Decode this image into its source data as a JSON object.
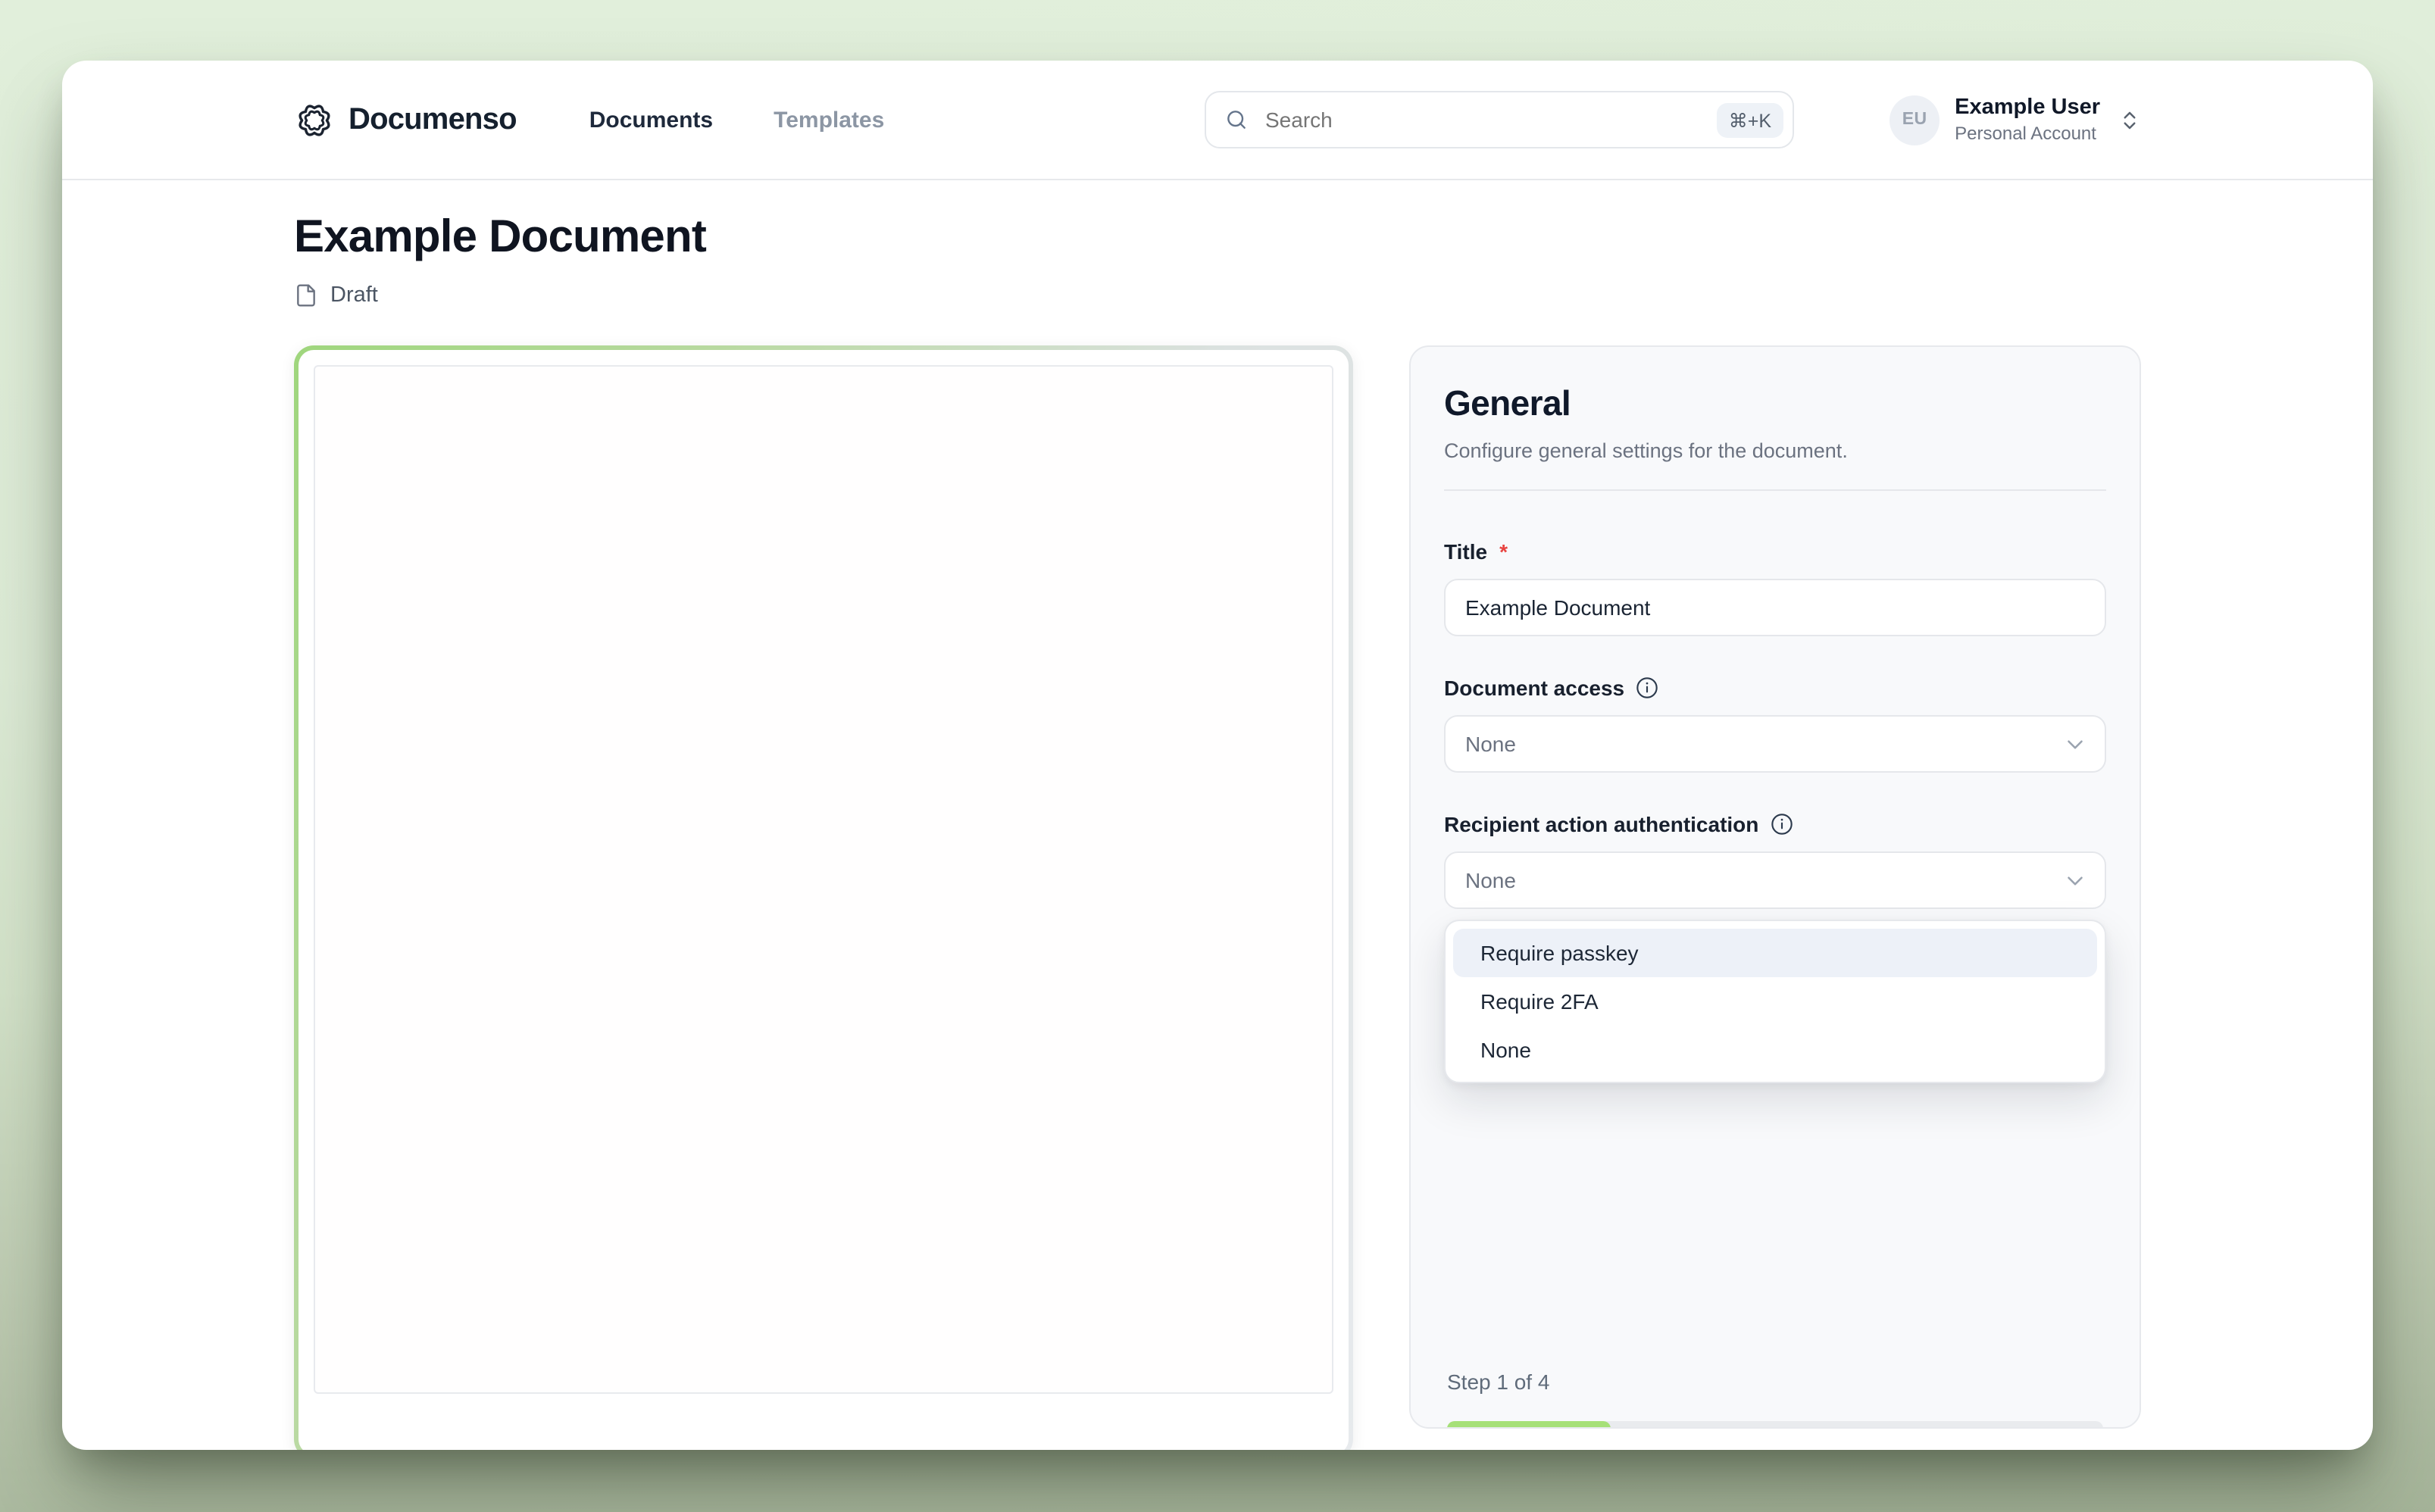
{
  "header": {
    "logo_text": "Documenso",
    "nav": [
      {
        "label": "Documents",
        "active": true
      },
      {
        "label": "Templates",
        "active": false
      }
    ],
    "search": {
      "placeholder": "Search",
      "shortcut": "⌘+K"
    },
    "user": {
      "initials": "EU",
      "name": "Example User",
      "account_type": "Personal Account"
    }
  },
  "document": {
    "title": "Example Document",
    "status": "Draft"
  },
  "panel": {
    "title": "General",
    "subtitle": "Configure general settings for the document.",
    "fields": {
      "title": {
        "label": "Title",
        "required_mark": "*",
        "value": "Example Document"
      },
      "document_access": {
        "label": "Document access",
        "value": "None"
      },
      "recipient_auth": {
        "label": "Recipient action authentication",
        "value": "None"
      }
    },
    "dropdown": {
      "options": [
        {
          "label": "Require passkey",
          "highlighted": true
        },
        {
          "label": "Require 2FA",
          "highlighted": false
        },
        {
          "label": "None",
          "highlighted": false
        }
      ]
    },
    "footer": {
      "step_text": "Step 1 of 4",
      "progress_percent": 25,
      "progress_style": "width:25%"
    }
  },
  "colors": {
    "accent_green": "#a6e078",
    "border_green": "#9fd67d",
    "brand_dark": "#1b2330",
    "background_green": "#e1efdb",
    "muted_text": "#6b7280"
  }
}
